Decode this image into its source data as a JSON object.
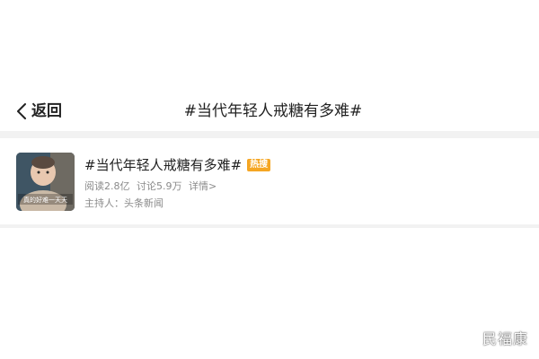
{
  "nav": {
    "back_label": "返回",
    "title": "#当代年轻人戒糖有多难#"
  },
  "topic": {
    "title": "#当代年轻人戒糖有多难#",
    "badge": "热搜",
    "reads": "阅读2.8亿",
    "discussions": "讨论5.9万",
    "details_link": "详情>",
    "host_label": "主持人：",
    "host_name": "头条新闻",
    "thumbnail_caption": "真的好难一天天"
  },
  "watermark": "民福康",
  "colors": {
    "badge": "#f5a623",
    "text_primary": "#222222",
    "text_secondary": "#8a8a8a",
    "divider": "#f2f2f2"
  }
}
